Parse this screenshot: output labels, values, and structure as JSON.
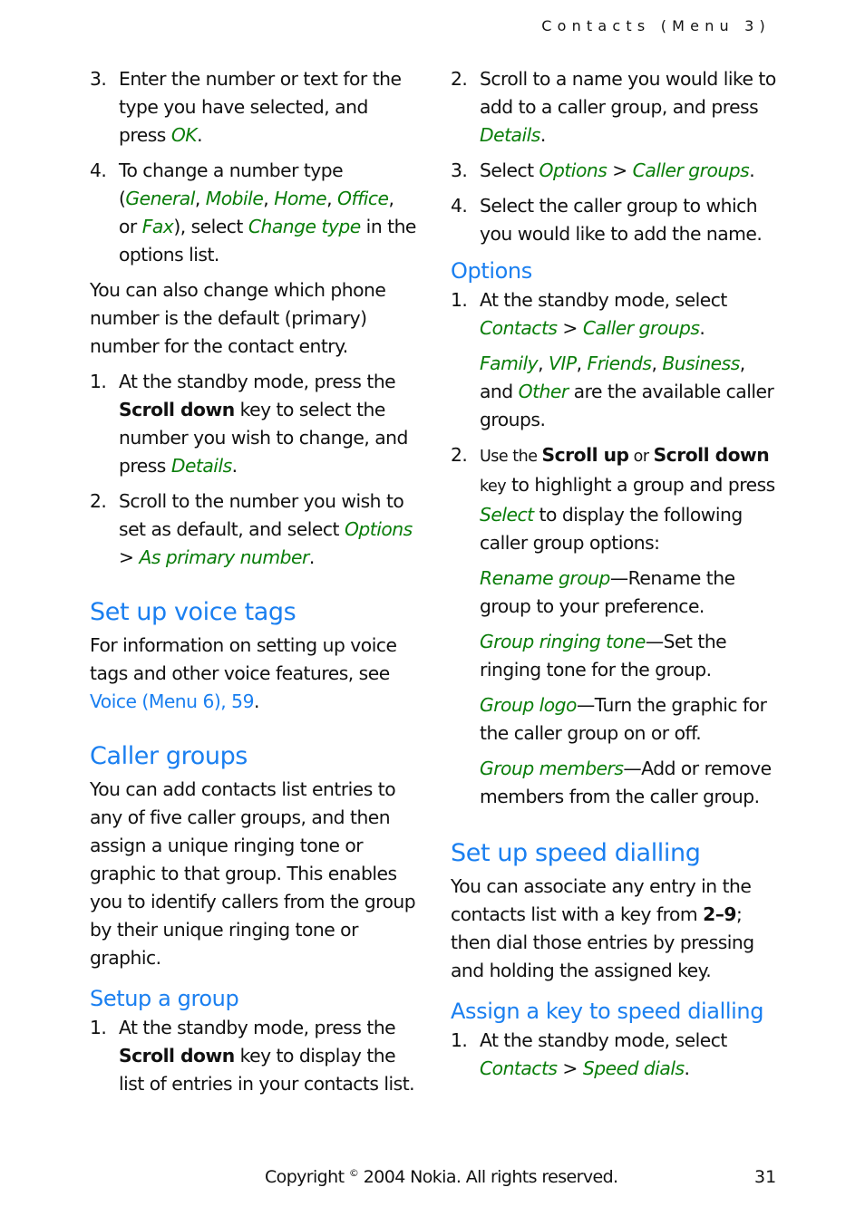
{
  "header": {
    "running_head": "Contacts (Menu 3)"
  },
  "left": {
    "step3": {
      "num": "3.",
      "t1": "Enter the number or text for the type you have selected, and press ",
      "ok": "OK",
      "t2": "."
    },
    "step4": {
      "num": "4.",
      "t1": "To change a number type (",
      "general": "General",
      "c1": ", ",
      "mobile": "Mobile",
      "c2": ", ",
      "home": "Home",
      "c3": ", ",
      "office": "Office",
      "c4": ", or ",
      "fax": "Fax",
      "t2": "), select ",
      "change_type": "Change type",
      "t3": " in the options list."
    },
    "default_para": "You can also change which phone number is the default (primary) number for the contact entry.",
    "def_step1": {
      "num": "1.",
      "t1": "At the standby mode, press the ",
      "key": "Scroll down",
      "t2": " key to select the number you wish to change, and press ",
      "details": "Details",
      "t3": "."
    },
    "def_step2": {
      "num": "2.",
      "t1": "Scroll to the number you wish to set as default, and select ",
      "options": "Options",
      "t2": " > ",
      "primary": "As primary number",
      "t3": "."
    },
    "voice_heading": "Set up voice tags",
    "voice_para": "For information on setting up voice tags and other voice features, see ",
    "voice_link": "Voice (Menu 6), 59",
    "voice_end": ".",
    "caller_heading": "Caller groups",
    "caller_para": "You can add contacts list entries to any of five caller groups, and then assign a unique ringing tone or graphic to that group. This enables you to identify callers from the group by their unique ringing tone or graphic.",
    "setup_heading": "Setup a group",
    "setup_step1": {
      "num": "1.",
      "t1": "At the standby mode, press the ",
      "key": "Scroll down",
      "t2": " key to display the list of entries in your contacts list."
    }
  },
  "right": {
    "step2": {
      "num": "2.",
      "t1": "Scroll to a name you would like to add to a caller group, and press ",
      "details": "Details",
      "t2": "."
    },
    "step3": {
      "num": "3.",
      "t1": "Select ",
      "options": "Options",
      "t2": " > ",
      "caller_groups": "Caller groups",
      "t3": "."
    },
    "step4": {
      "num": "4.",
      "t1": "Select the caller group to which you would like to add the name."
    },
    "options_heading": "Options",
    "opt_step1": {
      "num": "1.",
      "t1": "At the standby mode, select ",
      "contacts": "Contacts",
      "t2": " > ",
      "caller_groups": "Caller groups",
      "t3": "."
    },
    "groups": {
      "family": "Family",
      "vip": "VIP",
      "friends": "Friends",
      "business": "Business",
      "other": "Other",
      "c": ", ",
      "and": "and ",
      "tail": " are the available caller groups."
    },
    "opt_step2": {
      "num": "2.",
      "t0": "Use the ",
      "up": "Scroll up",
      "or": " or ",
      "down": "Scroll down",
      "key": "key",
      "t1": " to highlight a group and press ",
      "select": "Select",
      "t2": " to display the following caller group options:"
    },
    "group_options": [
      {
        "name": "Rename group",
        "desc": "—Rename the group to your preference."
      },
      {
        "name": "Group ringing tone",
        "desc": "—Set the ringing tone for the group."
      },
      {
        "name": "Group logo",
        "desc": "—Turn the graphic for the caller group on or off."
      },
      {
        "name": "Group members",
        "desc": "—Add or remove members from the caller group."
      }
    ],
    "speed_heading": "Set up speed dialling",
    "speed_para": {
      "t1": "You can associate any entry in the contacts list with a key from ",
      "keys": "2–9",
      "t2": "; then dial those entries by pressing and holding the assigned key."
    },
    "assign_heading": "Assign a key to speed dialling",
    "assign_step1": {
      "num": "1.",
      "t1": "At the standby mode, select ",
      "contacts": "Contacts",
      "t2": " > ",
      "speed": "Speed dials",
      "t3": "."
    }
  },
  "footer": {
    "copyright_pre": "Copyright ",
    "symbol": "©",
    "copyright_post": " 2004 Nokia. All rights reserved.",
    "page_number": "31"
  },
  "colors": {
    "heading_blue": "#1a7ff0",
    "menu_green": "#0a7d0a",
    "text": "#111111"
  }
}
